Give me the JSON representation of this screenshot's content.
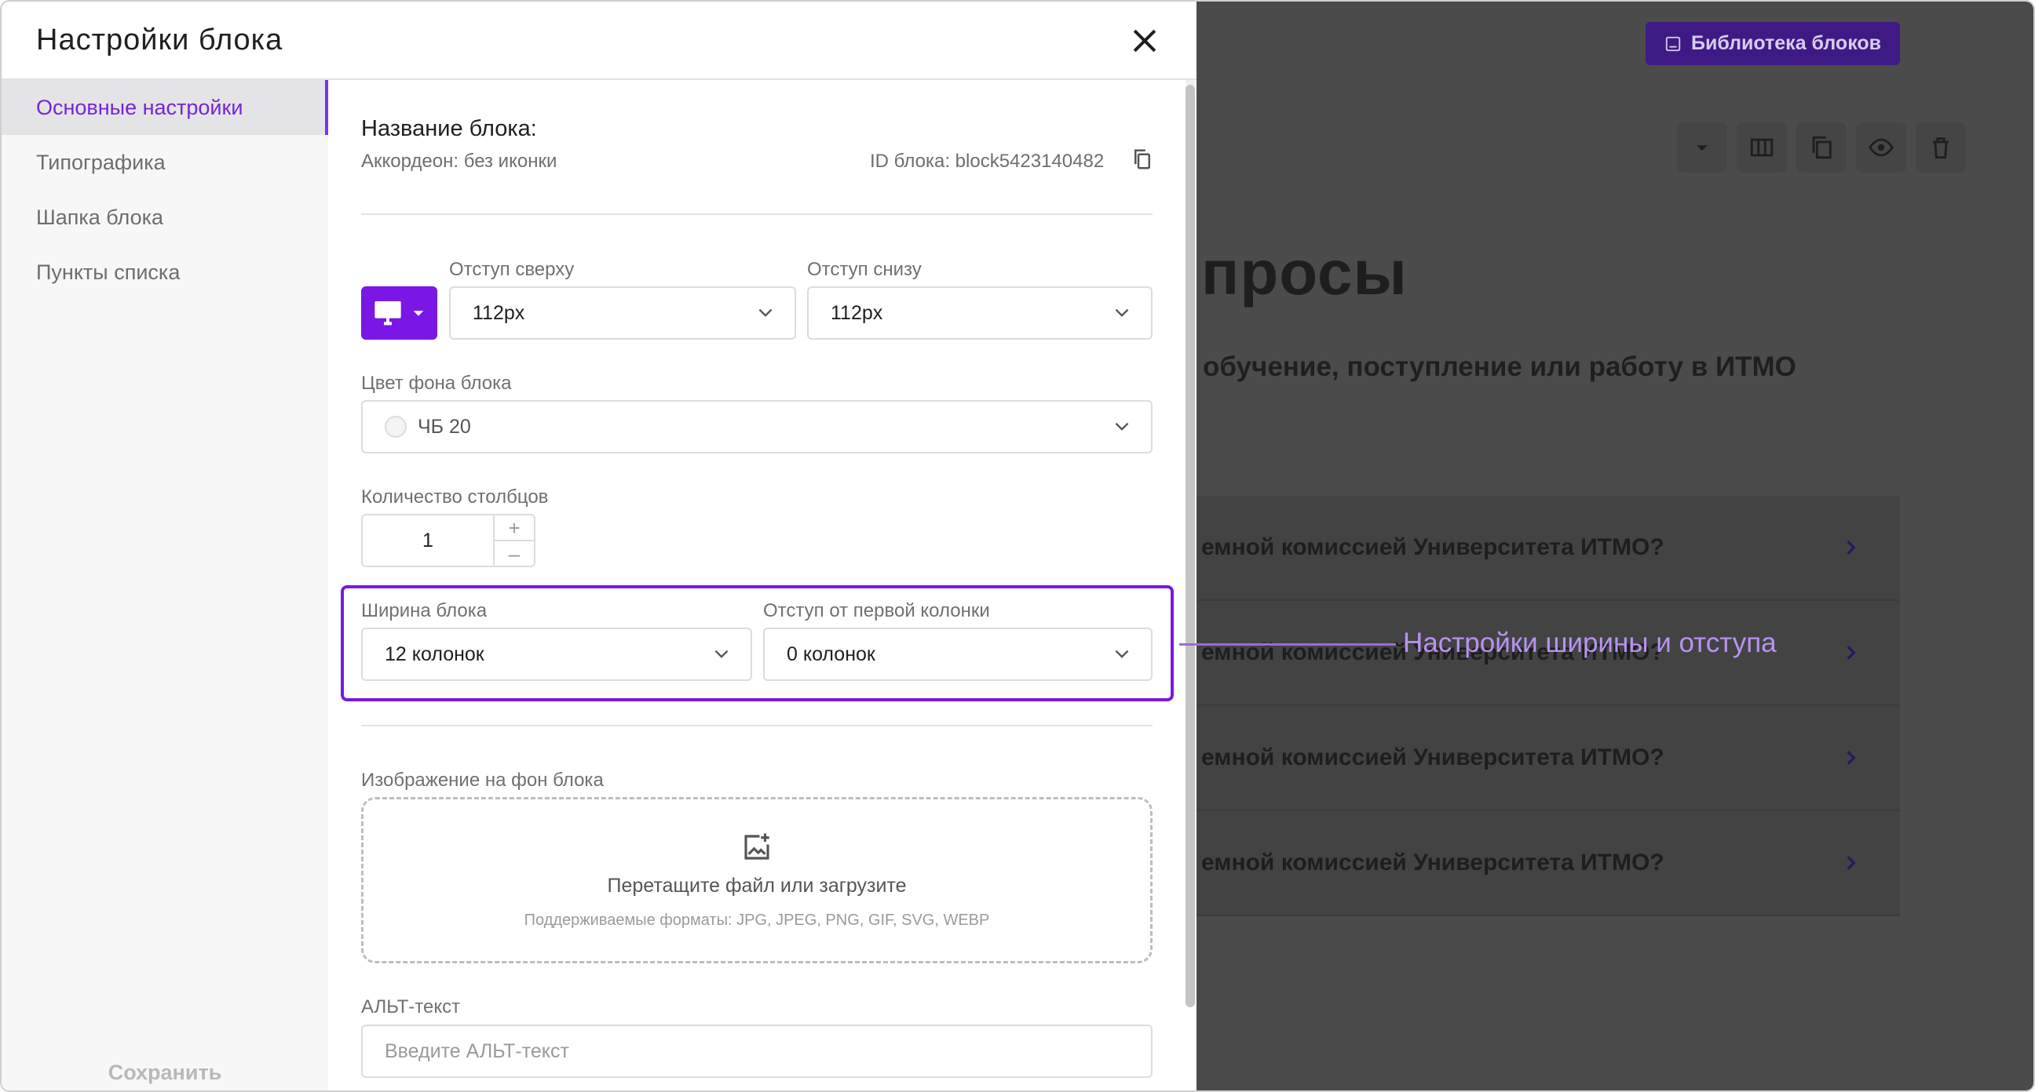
{
  "modal": {
    "title": "Настройки блока",
    "close_icon": "close-icon",
    "sidebar": {
      "items": [
        {
          "label": "Основные настройки",
          "active": true
        },
        {
          "label": "Типографика",
          "active": false
        },
        {
          "label": "Шапка блока",
          "active": false
        },
        {
          "label": "Пункты списка",
          "active": false
        }
      ],
      "save_label": "Сохранить"
    },
    "block_name_label": "Название блока:",
    "block_name_value": "Аккордеон: без иконки",
    "block_id_text": "ID блока: block5423140482",
    "copy_icon": "copy-icon",
    "device_icon": "desktop-icon",
    "padding_top": {
      "label": "Отступ сверху",
      "value": "112px"
    },
    "padding_bottom": {
      "label": "Отступ снизу",
      "value": "112px"
    },
    "bg_color": {
      "label": "Цвет фона блока",
      "value": "ЧБ 20"
    },
    "columns_count": {
      "label": "Количество столбцов",
      "value": "1",
      "plus": "+",
      "minus": "–"
    },
    "block_width": {
      "label": "Ширина блока",
      "value": "12 колонок"
    },
    "offset_first_col": {
      "label": "Отступ от первой колонки",
      "value": "0 колонок"
    },
    "bg_image": {
      "label": "Изображение на фон блока",
      "drop_title": "Перетащите файл или загрузите",
      "drop_formats": "Поддерживаемые форматы: JPG, JPEG, PNG, GIF, SVG, WEBP"
    },
    "alt_text": {
      "label": "АЛЬТ-текст",
      "placeholder": "Введите АЛЬТ-текст"
    }
  },
  "annotation": {
    "text": "Настройки ширины и отступа",
    "color": "#b893f0"
  },
  "background_page": {
    "library_button": "Библиотека блоков",
    "heading_fragment": "просы",
    "subtitle_fragment": "обучение, поступление или работу в ИТМО",
    "accordion_items": [
      "емной комиссией Университета ИТМО?",
      "емной комиссией Университета ИТМО?",
      "емной комиссией Университета ИТМО?",
      "емной комиссией Университета ИТМО?"
    ]
  },
  "colors": {
    "accent": "#7a17e6",
    "overlay": "#4b4b4b",
    "library_button": "#3e1b84"
  }
}
